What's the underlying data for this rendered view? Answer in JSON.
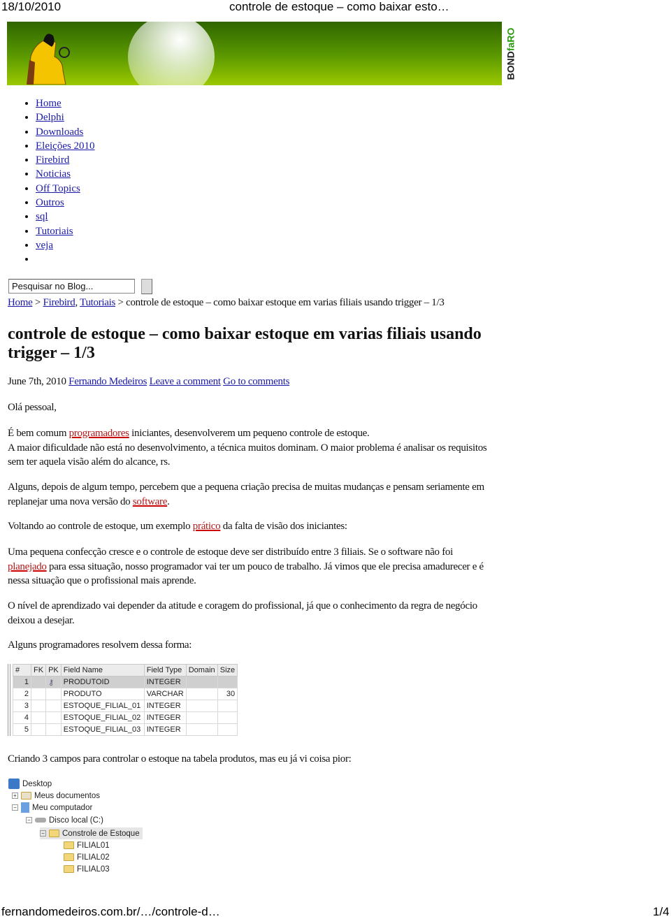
{
  "print_header": {
    "date": "18/10/2010",
    "title": "controle de estoque – como baixar esto…"
  },
  "print_footer": {
    "url": "fernandomedeiros.com.br/…/controle-d…",
    "page": "1/4"
  },
  "banner": {
    "logo_text_a": "BOND",
    "logo_text_b": "faRO",
    "colors": {
      "green_dark": "#2f6500",
      "green_light": "#9cc800"
    }
  },
  "nav": [
    "Home",
    "Delphi",
    "Downloads",
    "Eleições 2010",
    "Firebird",
    "Noticias",
    "Off Topics",
    "Outros",
    "sql",
    "Tutoriais",
    "veja",
    ""
  ],
  "search": {
    "value": "Pesquisar no Blog..."
  },
  "breadcrumb": {
    "home": "Home",
    "sep1": " > ",
    "cat1": "Firebird",
    "comma": ", ",
    "cat2": "Tutoriais",
    "rest": " > controle de estoque – como baixar estoque em varias filiais usando trigger – 1/3"
  },
  "post": {
    "title": "controle de estoque – como baixar estoque em varias filiais usando trigger – 1/3",
    "date": "June 7th, 2010 ",
    "author": "Fernando Medeiros",
    "leave_comment": "Leave a comment",
    "go_comments": "Go to comments",
    "p1": "Olá pessoal,",
    "p2a": "É bem comum ",
    "p2link": "programadores",
    "p2b": " iniciantes, desenvolverem um pequeno controle de estoque.",
    "p2c": "A maior dificuldade não está no desenvolvimento, a técnica muitos dominam. O maior problema é analisar os requisitos sem ter aquela visão além do alcance, rs.",
    "p3a": "Alguns, depois de algum tempo, percebem que a pequena criação precisa de muitas mudanças e pensam seriamente em replanejar uma nova versão do ",
    "p3link": "software",
    "p3b": ".",
    "p4a": "Voltando ao controle de estoque, um exemplo ",
    "p4link": "prático",
    "p4b": " da falta de visão dos iniciantes:",
    "p5a": "Uma pequena confecção cresce e o controle de estoque deve ser distribuído entre 3 filiais. Se o software não foi ",
    "p5link": "planejado",
    "p5b": " para essa situação, nosso programador vai ter um pouco de trabalho. Já vimos que ele precisa amadurecer e é nessa situação que o profissional mais aprende.",
    "p6": "O nível de aprendizado vai depender da atitude e coragem do profissional, já que o conhecimento da regra de negócio deixou a desejar.",
    "p7": "Alguns programadores resolvem dessa forma:",
    "p8": "Criando 3 campos para controlar o estoque na tabela produtos, mas eu já vi coisa pior:"
  },
  "table": {
    "headers": [
      "#",
      "FK",
      "PK",
      "Field Name",
      "Field Type",
      "Domain",
      "Size"
    ],
    "rows": [
      [
        "1",
        "",
        "",
        "PRODUTOID",
        "INTEGER",
        "",
        ""
      ],
      [
        "2",
        "",
        "",
        "PRODUTO",
        "VARCHAR",
        "",
        "30"
      ],
      [
        "3",
        "",
        "",
        "ESTOQUE_FILIAL_01",
        "INTEGER",
        "",
        ""
      ],
      [
        "4",
        "",
        "",
        "ESTOQUE_FILIAL_02",
        "INTEGER",
        "",
        ""
      ],
      [
        "5",
        "",
        "",
        "ESTOQUE_FILIAL_03",
        "INTEGER",
        "",
        ""
      ]
    ]
  },
  "tree": [
    "Desktop",
    "Meus documentos",
    "Meu computador",
    "Disco local (C:)",
    "Constrole de Estoque",
    "FILIAL01",
    "FILIAL02",
    "FILIAL03"
  ]
}
